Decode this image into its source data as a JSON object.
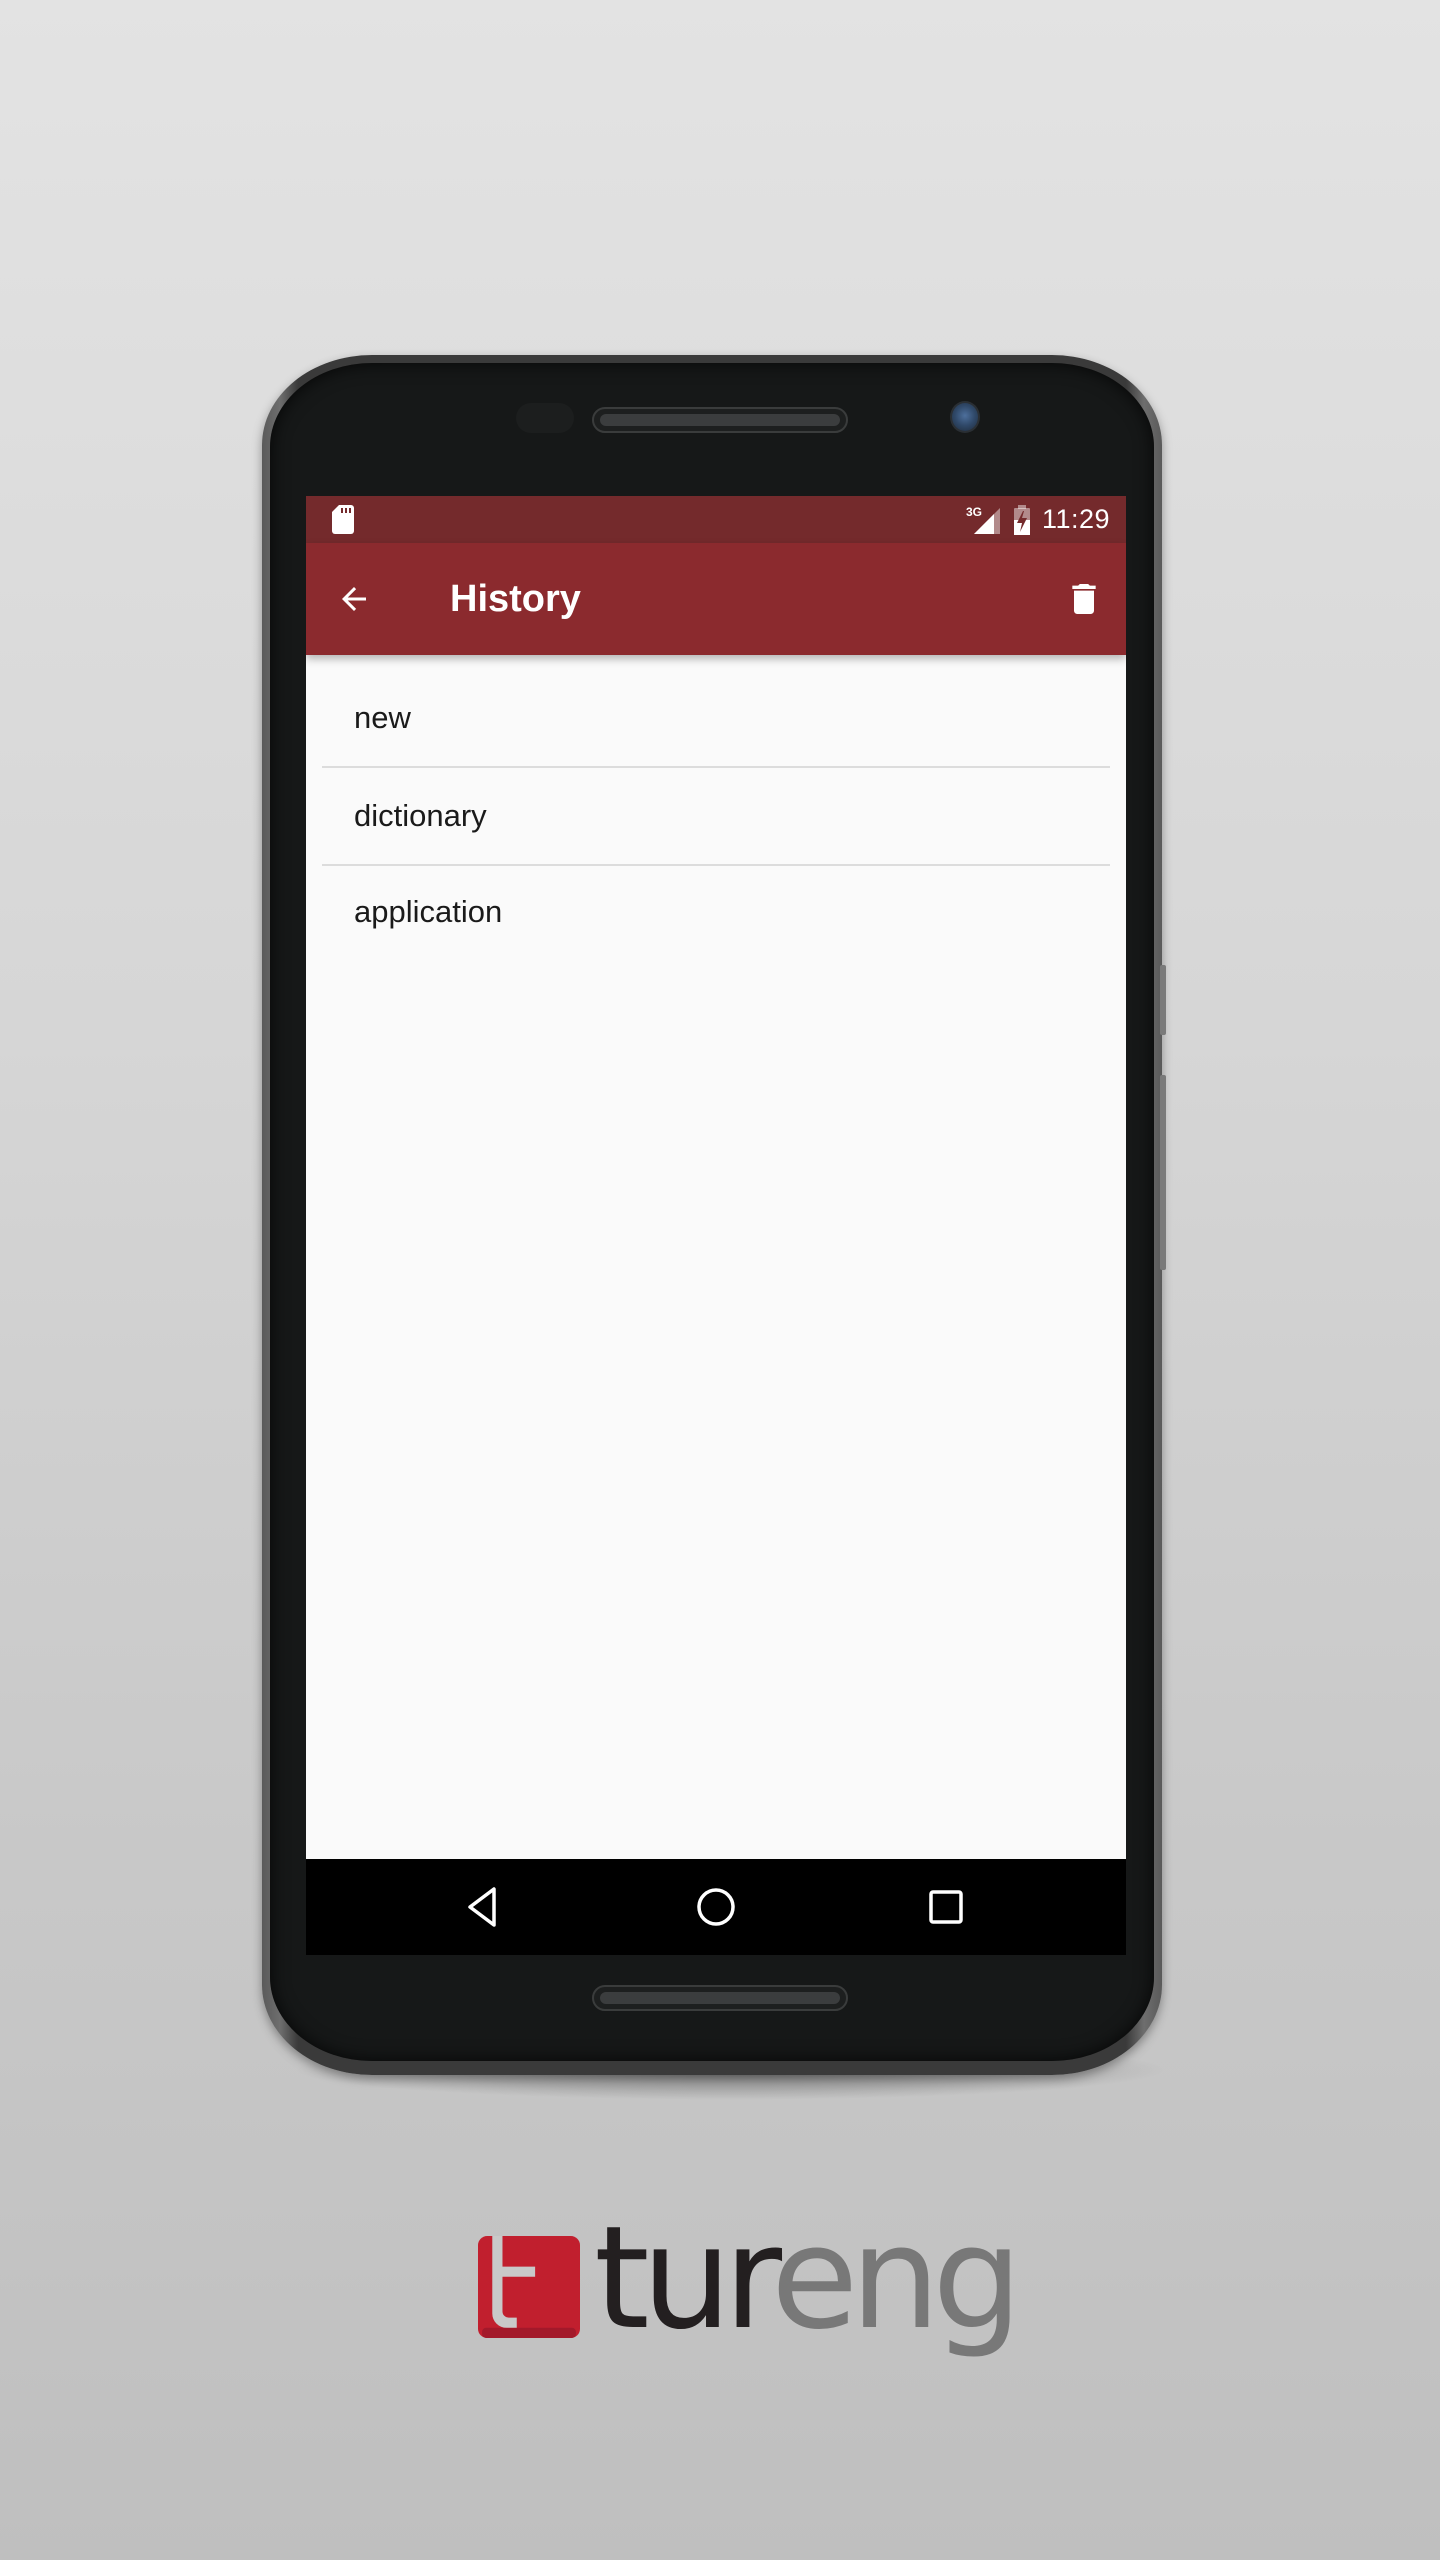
{
  "status_bar": {
    "left_icons": [
      "sd-card-icon"
    ],
    "network": "3G",
    "right_icons": [
      "signal-icon",
      "battery-charging-icon"
    ],
    "time": "11:29"
  },
  "app_bar": {
    "back_icon": "arrow-back-icon",
    "title": "History",
    "action_icon": "trash-icon"
  },
  "history": {
    "items": [
      {
        "label": "new"
      },
      {
        "label": "dictionary"
      },
      {
        "label": "application"
      }
    ]
  },
  "nav_bar": {
    "buttons": [
      "back-triangle-icon",
      "home-circle-icon",
      "recents-square-icon"
    ]
  },
  "branding": {
    "logo_dark": "tur",
    "logo_light": "eng",
    "logo_color": "#c11f2e"
  },
  "colors": {
    "status_bar": "#742a2c",
    "app_bar": "#8b2a2e",
    "list_background": "#fafafa"
  }
}
